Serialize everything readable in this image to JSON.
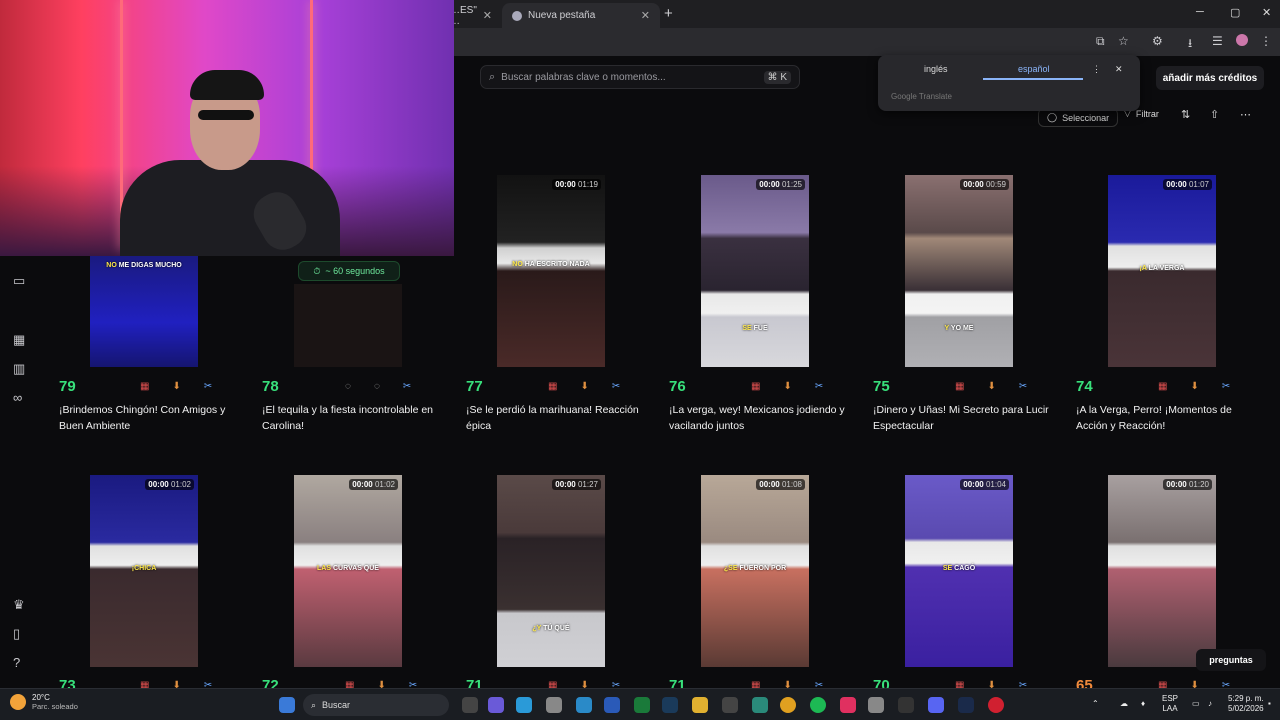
{
  "browser": {
    "tabs": [
      {
        "label": "…ES\" …"
      },
      {
        "label": "Nueva pestaña"
      }
    ],
    "new_tab": "+",
    "window_controls": [
      "─",
      "▢",
      "✕"
    ]
  },
  "translate_popup": {
    "lang_from": "inglés",
    "lang_to": "español",
    "brand": "Google Translate"
  },
  "header": {
    "search_placeholder": "Buscar palabras clave o momentos...",
    "search_shortcut": "⌘ K",
    "credits_button": "añadir más créditos",
    "select_button": "Seleccionar",
    "filter_button": "Filtrar"
  },
  "timer_chip": "~ 60 segundos",
  "cards": [
    {
      "score": "79",
      "title": "¡Brindemos Chingón! Con Amigos y Buen Ambiente",
      "caption_hl": "NO",
      "caption": "ME DIGAS MUCHO"
    },
    {
      "score": "78",
      "title": "¡El tequila y la fiesta incontrolable en Carolina!",
      "caption_hl": "",
      "caption": ""
    },
    {
      "score": "77",
      "elapsed": "00:00",
      "total": "01:19",
      "title": "¡Se le perdió la marihuana! Reacción épica",
      "caption_hl": "NO",
      "caption": "HA ESCRITO NADA"
    },
    {
      "score": "76",
      "elapsed": "00:00",
      "total": "01:25",
      "title": "¡La verga, wey! Mexicanos jodiendo y vacilando juntos",
      "caption_hl": "SE",
      "caption": "FUE"
    },
    {
      "score": "75",
      "elapsed": "00:00",
      "total": "00:59",
      "title": "¡Dinero y Uñas! Mi Secreto para Lucir Espectacular",
      "caption_hl": "Y",
      "caption": "YO ME"
    },
    {
      "score": "74",
      "elapsed": "00:00",
      "total": "01:07",
      "title": "¡A la Verga, Perro! ¡Momentos de Acción y Reacción!",
      "caption_hl": "¡A",
      "caption": "LA VERGA"
    },
    {
      "score": "73",
      "elapsed": "00:00",
      "total": "01:02",
      "title": "",
      "caption_hl": "¡CHICA",
      "caption": ""
    },
    {
      "score": "72",
      "elapsed": "00:00",
      "total": "01:02",
      "title": "",
      "caption_hl": "LAS",
      "caption": "CURVAS QUE"
    },
    {
      "score": "71",
      "elapsed": "00:00",
      "total": "01:27",
      "title": "",
      "caption_hl": "¿Y",
      "caption": "TÚ QUÉ"
    },
    {
      "score": "71",
      "elapsed": "00:00",
      "total": "01:08",
      "title": "",
      "caption_hl": "¿SE",
      "caption": "FUERON POR"
    },
    {
      "score": "70",
      "elapsed": "00:00",
      "total": "01:04",
      "title": "",
      "caption_hl": "SE",
      "caption": "CAGÓ"
    },
    {
      "score": "65",
      "elapsed": "00:00",
      "total": "01:20",
      "title": "",
      "caption_hl": "",
      "caption": ""
    }
  ],
  "help_button": "preguntas",
  "taskbar": {
    "temp": "20°C",
    "weather": "Parc. soleado",
    "search": "Buscar",
    "lang1": "ESP",
    "lang2": "LAA",
    "time": "5:29 p. m.",
    "date": "5/02/2026"
  },
  "colors": {
    "score_green": "#38e07b",
    "score_orange": "#f08a3c",
    "accent_blue": "#8ab4f8"
  }
}
